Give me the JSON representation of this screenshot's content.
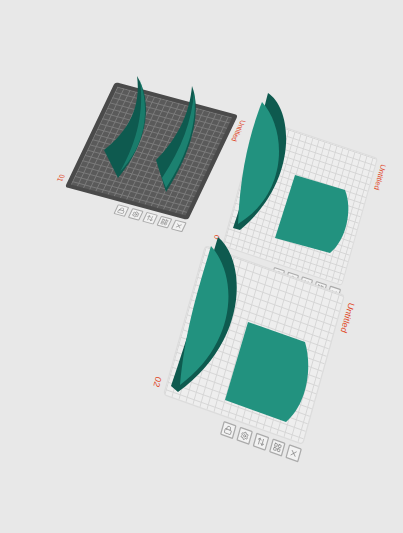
{
  "plates": [
    {
      "number": "01",
      "name": "Untitled",
      "selected": true
    },
    {
      "number": "0",
      "name": "Untitled",
      "selected": false
    },
    {
      "number": "02",
      "name": "Untitled",
      "selected": false
    }
  ]
}
